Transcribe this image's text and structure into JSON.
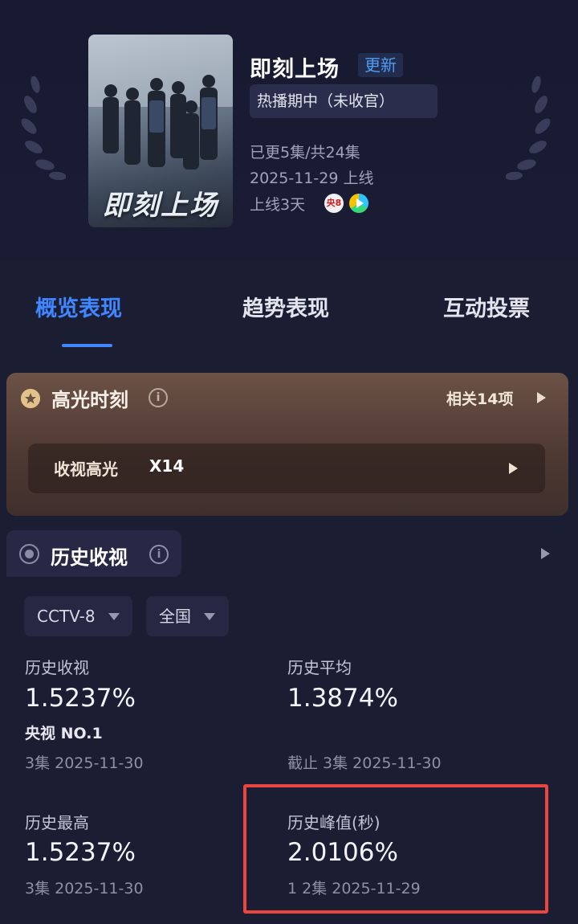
{
  "show": {
    "poster_title": "即刻上场",
    "title": "即刻上场",
    "update_badge": "更新",
    "status": "热播期中（未收官）",
    "episodes": "已更5集/共24集",
    "premiere": "2025-11-29 上线",
    "days_online": "上线3天",
    "channel_icon_text": "央8",
    "channels": [
      "cctv8-icon",
      "video-play-icon"
    ]
  },
  "tabs": [
    {
      "label": "概览表现",
      "active": true
    },
    {
      "label": "趋势表现",
      "active": false
    },
    {
      "label": "互动投票",
      "active": false
    }
  ],
  "highlights": {
    "title": "高光时刻",
    "related": "相关14项",
    "row_label": "收视高光",
    "row_count": "X14"
  },
  "history": {
    "title": "历史收视",
    "filters": {
      "channel": "CCTV-8",
      "region": "全国"
    },
    "stats": [
      {
        "label": "历史收视",
        "value": "1.5237%",
        "rank": "央视 NO.1",
        "sub": "3集 2025-11-30"
      },
      {
        "label": "历史平均",
        "value": "1.3874%",
        "sub": "截止 3集 2025-11-30"
      },
      {
        "label": "历史最高",
        "value": "1.5237%",
        "sub": "3集 2025-11-30"
      },
      {
        "label": "历史峰值(秒)",
        "value": "2.0106%",
        "sub": "1 2集 2025-11-29"
      }
    ]
  },
  "colors": {
    "accent": "#3f86ff",
    "highlight_box": "#e8463f",
    "background": "#1b1d33"
  }
}
